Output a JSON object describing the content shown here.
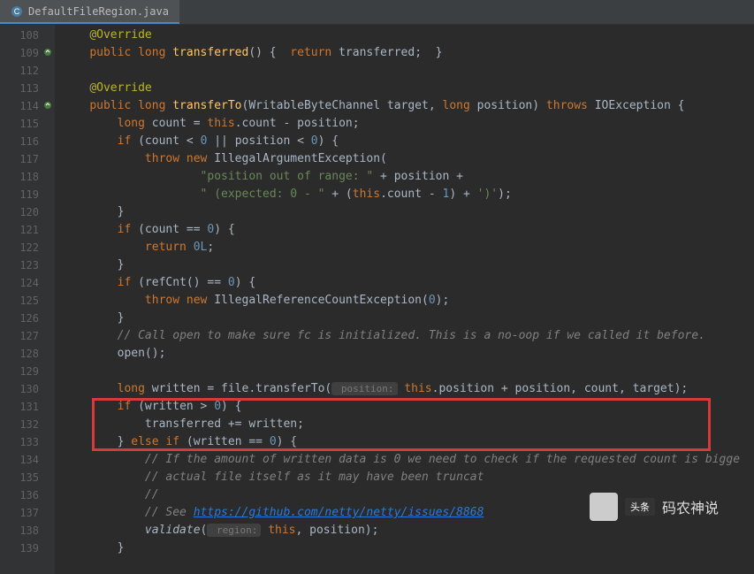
{
  "tab": {
    "filename": "DefaultFileRegion.java"
  },
  "gutter": {
    "start": 108,
    "lines": [
      108,
      109,
      112,
      113,
      114,
      115,
      116,
      117,
      118,
      119,
      120,
      121,
      122,
      123,
      124,
      125,
      126,
      127,
      128,
      129,
      130,
      131,
      132,
      133,
      134,
      135,
      136,
      137,
      138,
      139
    ]
  },
  "code": {
    "l108": "@Override",
    "l109_kw1": "public long",
    "l109_method": "transferred",
    "l109_kw2": "return",
    "l109_var": "transferred",
    "l113": "@Override",
    "l114_kw1": "public long",
    "l114_method": "transferTo",
    "l114_p1": "WritableByteChannel target",
    "l114_kw2": "long",
    "l114_p2": "position",
    "l114_kw3": "throws",
    "l114_ex": "IOException",
    "l115_kw": "long",
    "l115_rest": " count = ",
    "l115_this": "this",
    "l115_end": ".count - position;",
    "l116_kw": "if",
    "l116_cond": " (count < ",
    "l116_n1": "0",
    "l116_or": " || position < ",
    "l116_n2": "0",
    "l116_end": ") {",
    "l117_kw": "throw new",
    "l117_ex": " IllegalArgumentException(",
    "l118_str": "\"position out of range: \"",
    "l118_rest": " + position +",
    "l119_str": "\" (expected: 0 - \"",
    "l119_mid": " + (",
    "l119_this": "this",
    "l119_rest": ".count - ",
    "l119_n": "1",
    "l119_end": ") + ",
    "l119_str2": "')'",
    "l119_semi": ");",
    "l120": "}",
    "l121_kw": "if",
    "l121_rest": " (count == ",
    "l121_n": "0",
    "l121_end": ") {",
    "l122_kw": "return",
    "l122_val": " 0L",
    "l122_semi": ";",
    "l123": "}",
    "l124_kw": "if",
    "l124_rest": " (refCnt() == ",
    "l124_n": "0",
    "l124_end": ") {",
    "l125_kw": "throw new",
    "l125_ex": " IllegalReferenceCountException(",
    "l125_n": "0",
    "l125_end": ");",
    "l126": "}",
    "l127": "// Call open to make sure fc is initialized. This is a no-oop if we called it before.",
    "l128": "open();",
    "l130_kw": "long",
    "l130_var": " written = file.transferTo(",
    "l130_hint": " position:",
    "l130_this": "this",
    "l130_rest": ".position + position, count, target);",
    "l131_kw": "if",
    "l131_rest": " (written > ",
    "l131_n": "0",
    "l131_end": ") {",
    "l132": "transferred += written;",
    "l133_close": "} ",
    "l133_kw": "else if",
    "l133_rest": " (written == ",
    "l133_n": "0",
    "l133_end": ") {",
    "l134": "// If the amount of written data is 0 we need to check if the requested count is bigge",
    "l135": "// actual file itself as it may have been truncat",
    "l136": "//",
    "l137_c": "// See ",
    "l137_link": "https://github.com/netty/netty/issues/8868",
    "l138_call": "validate",
    "l138_open": "(",
    "l138_hint": " region:",
    "l138_this": "this",
    "l138_rest": ", position);",
    "l139": "}"
  },
  "watermark": {
    "badge": "头条",
    "text": "码农神说"
  }
}
